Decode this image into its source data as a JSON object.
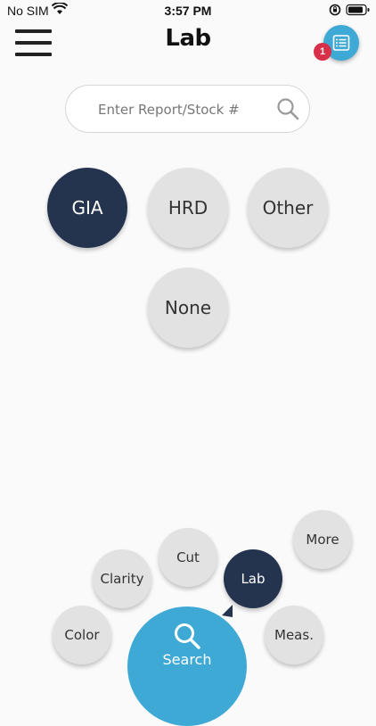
{
  "status_bar": {
    "carrier": "No SIM",
    "time": "3:57 PM"
  },
  "header": {
    "title": "Lab",
    "badge_count": "1"
  },
  "search": {
    "placeholder": "Enter Report/Stock #"
  },
  "lab_options": [
    "GIA",
    "HRD",
    "Other",
    "None"
  ],
  "selected_lab": "GIA",
  "bottom_nav": {
    "color": "Color",
    "clarity": "Clarity",
    "cut": "Cut",
    "lab": "Lab",
    "more": "More",
    "meas": "Meas.",
    "search": "Search"
  },
  "active_nav": "Lab",
  "colors": {
    "accent_blue": "#3fa9d6",
    "selected_navy": "#24344f",
    "bubble_gray": "#e2e2e2",
    "badge_red": "#d9304a"
  }
}
